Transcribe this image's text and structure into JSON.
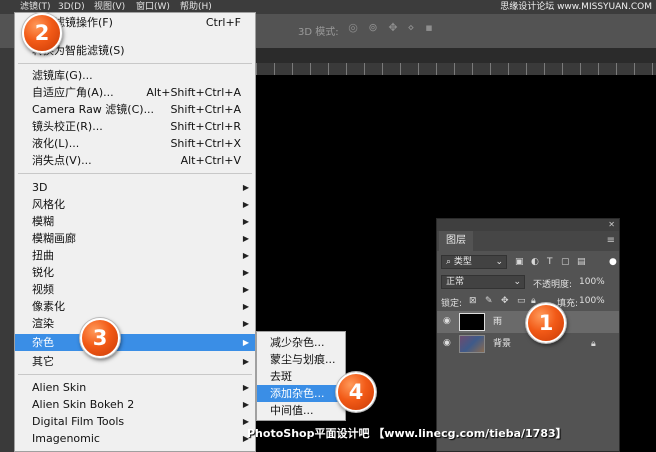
{
  "menubar": {
    "items": [
      "滤镜(T)",
      "3D(D)",
      "视图(V)",
      "窗口(W)",
      "帮助(H)"
    ]
  },
  "watermark": {
    "top": "思缘设计论坛 www.MISSYUAN.COM",
    "footer": "PhotoShop平面设计吧 【www.linecg.com/tieba/1783】"
  },
  "optbar": {
    "mode_label": "3D 模式:"
  },
  "filter_menu": {
    "items": [
      {
        "label": "上次滤镜操作(F)",
        "shortcut": "Ctrl+F"
      },
      {
        "label": "转换为智能滤镜(S)",
        "shortcut": ""
      },
      {
        "label": "滤镜库(G)...",
        "shortcut": ""
      },
      {
        "label": "自适应广角(A)...",
        "shortcut": "Alt+Shift+Ctrl+A"
      },
      {
        "label": "Camera Raw 滤镜(C)...",
        "shortcut": "Shift+Ctrl+A"
      },
      {
        "label": "镜头校正(R)...",
        "shortcut": "Shift+Ctrl+R"
      },
      {
        "label": "液化(L)...",
        "shortcut": "Shift+Ctrl+X"
      },
      {
        "label": "消失点(V)...",
        "shortcut": "Alt+Ctrl+V"
      },
      {
        "label": "3D"
      },
      {
        "label": "风格化"
      },
      {
        "label": "模糊"
      },
      {
        "label": "模糊画廊"
      },
      {
        "label": "扭曲"
      },
      {
        "label": "锐化"
      },
      {
        "label": "视频"
      },
      {
        "label": "像素化"
      },
      {
        "label": "渲染"
      },
      {
        "label": "杂色"
      },
      {
        "label": "其它"
      },
      {
        "label": "Alien Skin"
      },
      {
        "label": "Alien Skin Bokeh 2"
      },
      {
        "label": "Digital Film Tools"
      },
      {
        "label": "Imagenomic"
      }
    ]
  },
  "noise_submenu": {
    "items": [
      "减少杂色...",
      "蒙尘与划痕...",
      "去斑",
      "添加杂色...",
      "中间值..."
    ]
  },
  "layers_panel": {
    "tab": "图层",
    "filter_kind": "类型",
    "blend_mode": "正常",
    "opacity_label": "不透明度:",
    "opacity_value": "100%",
    "lock_label": "锁定:",
    "fill_label": "填充:",
    "fill_value": "100%",
    "layers": [
      {
        "name": "雨"
      },
      {
        "name": "背景"
      }
    ]
  },
  "badges": [
    "1",
    "2",
    "3",
    "4"
  ]
}
